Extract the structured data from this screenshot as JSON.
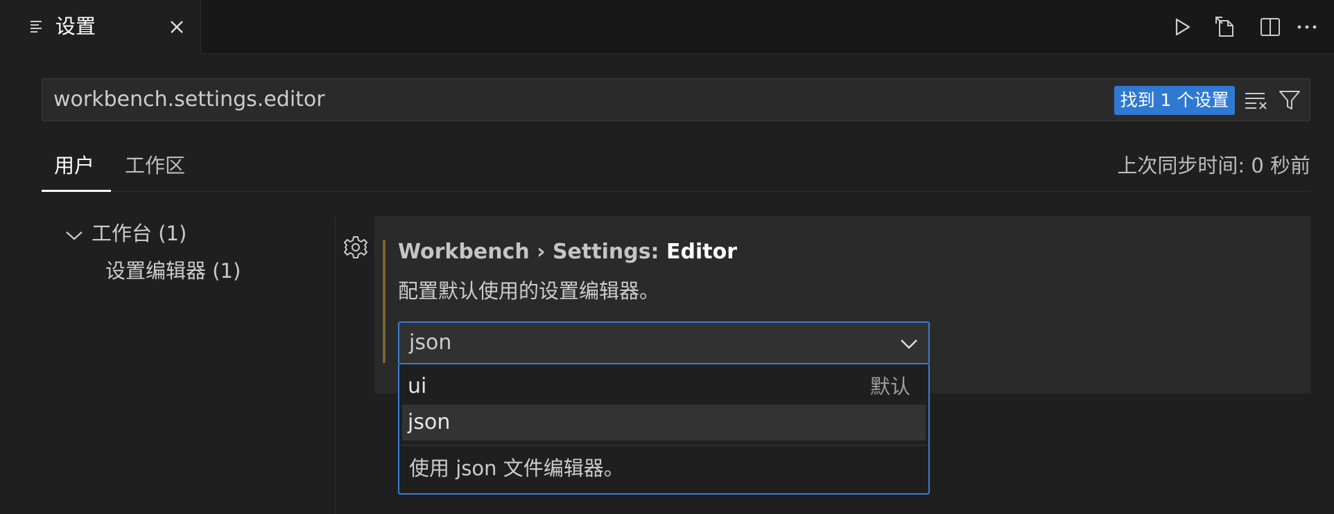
{
  "tab": {
    "title": "设置",
    "icon": "settings-list-icon",
    "close_icon": "close-icon"
  },
  "toolbar": {
    "actions": [
      {
        "name": "run-icon"
      },
      {
        "name": "open-settings-json-icon"
      },
      {
        "name": "split-editor-icon"
      },
      {
        "name": "more-actions-icon"
      }
    ]
  },
  "search": {
    "value": "workbench.settings.editor",
    "result_count": "找到 1 个设置",
    "clear_icon": "clear-filter-icon",
    "filter_icon": "filter-icon"
  },
  "scopes": {
    "user": "用户",
    "workspace": "工作区",
    "active": "user",
    "sync_status": "上次同步时间: 0 秒前"
  },
  "toc": {
    "group": "工作台 (1)",
    "child": "设置编辑器 (1)"
  },
  "setting": {
    "title_prefix": "Workbench › Settings: ",
    "title_key": "Editor",
    "description": "配置默认使用的设置编辑器。",
    "value": "json",
    "options": [
      {
        "label": "ui",
        "default_badge": "默认"
      },
      {
        "label": "json",
        "default_badge": ""
      }
    ],
    "selected_index": 1,
    "option_description": "使用 json 文件编辑器。"
  },
  "colors": {
    "accent": "#3a7dd6",
    "badge": "#2f79d3",
    "modified": "#7a6334",
    "background": "#1f1f1f"
  }
}
